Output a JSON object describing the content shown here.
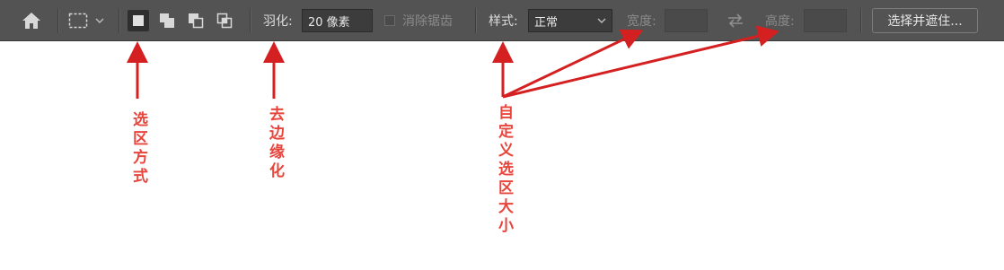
{
  "toolbar": {
    "feather_label": "羽化:",
    "feather_value": "20 像素",
    "antialias_label": "消除锯齿",
    "style_label": "样式:",
    "style_value": "正常",
    "width_label": "宽度:",
    "height_label": "高度:",
    "select_mask_button": "选择并遮住..."
  },
  "annotations": {
    "selection_mode": "选区方式",
    "feather": "去边缘化",
    "custom_size": "自定义选区大小"
  },
  "colors": {
    "toolbar_bg": "#535353",
    "annotation": "#e8453c",
    "arrow": "#d42020"
  },
  "icons": [
    "home-icon",
    "marquee-rect-icon",
    "chevron-down-icon",
    "new-selection-icon",
    "add-selection-icon",
    "subtract-selection-icon",
    "intersect-selection-icon",
    "swap-icon"
  ]
}
